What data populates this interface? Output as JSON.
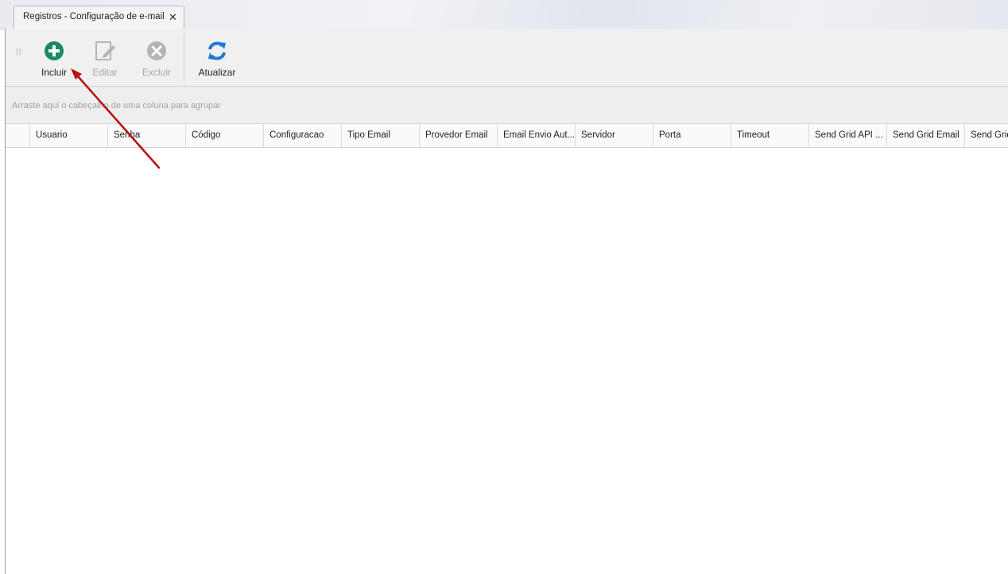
{
  "tab": {
    "title": "Registros - Configuração de e-mail",
    "close_glyph": "✕"
  },
  "toolbar": {
    "buttons": [
      {
        "label": "Incluir",
        "icon": "plus-circle-icon",
        "color": "#1b8a62",
        "enabled": true
      },
      {
        "label": "Editar",
        "icon": "edit-icon",
        "color": "#b5b5b5",
        "enabled": false
      },
      {
        "label": "Excluir",
        "icon": "x-circle-icon",
        "color": "#b5b5b5",
        "enabled": false
      },
      {
        "label": "Atualizar",
        "icon": "refresh-icon",
        "color": "#1e78d6",
        "enabled": true
      }
    ]
  },
  "grid": {
    "group_hint": "Arraste aqui o cabeçalho de uma coluna para agrupar",
    "columns": [
      "Usuario",
      "Senha",
      "Código",
      "Configuracao",
      "Tipo Email",
      "Provedor Email",
      "Email Envio Aut...",
      "Servidor",
      "Porta",
      "Timeout",
      "Send Grid API ...",
      "Send Grid Email",
      "Send Grid"
    ]
  },
  "annotation": {
    "color": "#b80f0f"
  }
}
